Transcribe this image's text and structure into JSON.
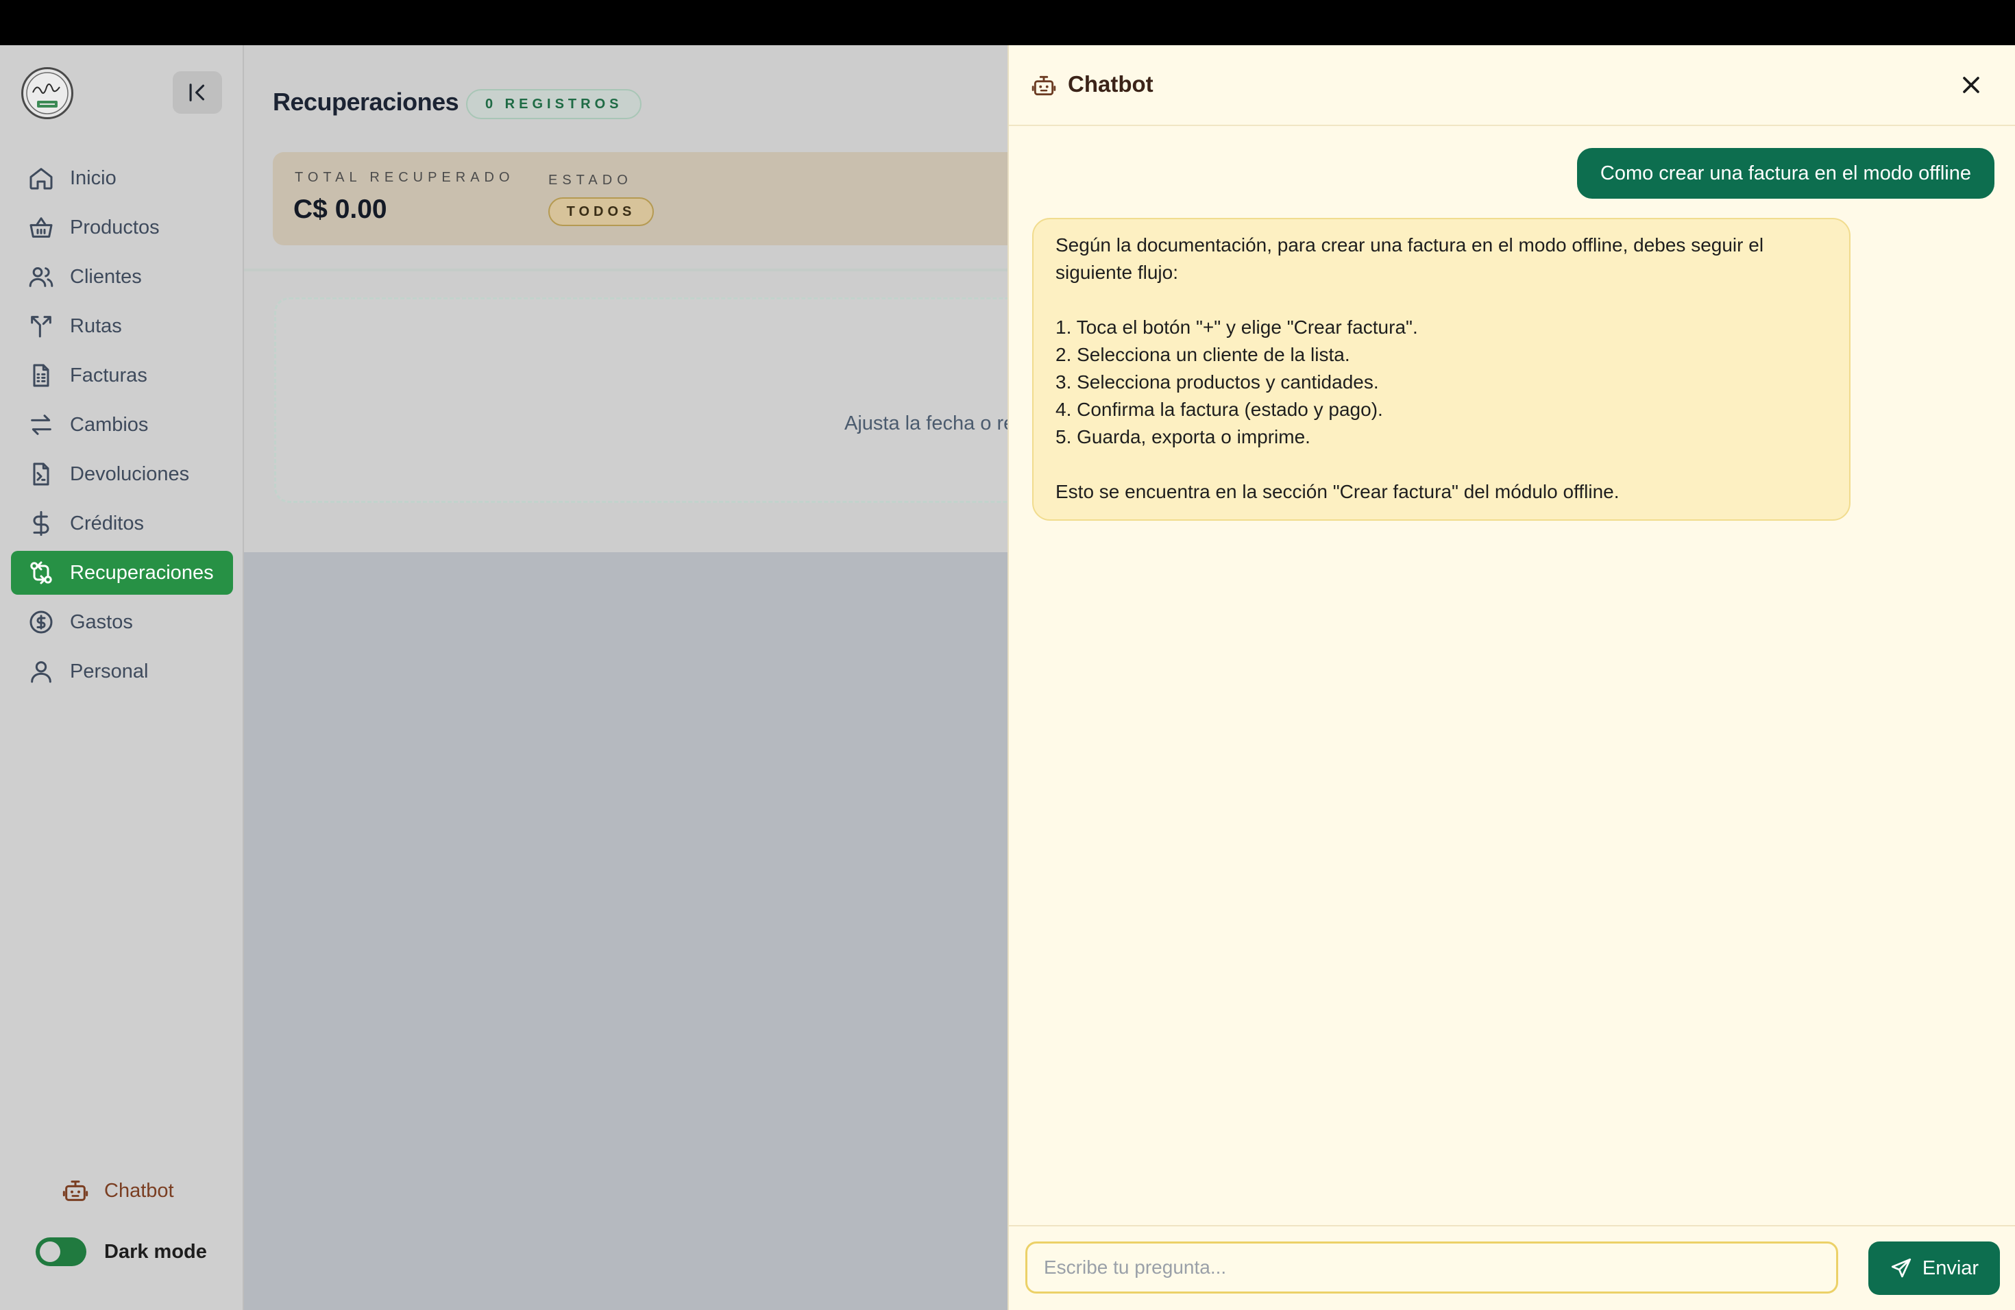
{
  "sidebar": {
    "logo_alt": "Ari-Cafe P&D logo",
    "items": [
      {
        "label": "Inicio",
        "icon": "home-icon"
      },
      {
        "label": "Productos",
        "icon": "basket-icon"
      },
      {
        "label": "Clientes",
        "icon": "users-icon"
      },
      {
        "label": "Rutas",
        "icon": "route-icon"
      },
      {
        "label": "Facturas",
        "icon": "invoice-icon"
      },
      {
        "label": "Cambios",
        "icon": "swap-icon"
      },
      {
        "label": "Devoluciones",
        "icon": "return-file-icon"
      },
      {
        "label": "Créditos",
        "icon": "dollar-icon"
      },
      {
        "label": "Recuperaciones",
        "icon": "recovery-icon",
        "active": true
      },
      {
        "label": "Gastos",
        "icon": "coin-icon"
      },
      {
        "label": "Personal",
        "icon": "person-icon"
      }
    ],
    "chatbot_label": "Chatbot",
    "dark_mode_label": "Dark mode"
  },
  "main": {
    "title": "Recuperaciones",
    "records_badge": "0 REGISTROS",
    "summary": {
      "total_label": "TOTAL RECUPERADO",
      "total_value": "C$ 0.00",
      "estado_label": "ESTADO",
      "estado_value": "TODOS"
    },
    "empty_text": "Ajusta la fecha o re"
  },
  "chat": {
    "title": "Chatbot",
    "messages": [
      {
        "role": "user",
        "text": "Como crear una factura en el modo offline"
      },
      {
        "role": "bot",
        "text": "Según la documentación, para crear una factura en el modo offline, debes seguir el siguiente flujo:\n\n1. Toca el botón \"+\" y elige \"Crear factura\".\n2. Selecciona un cliente de la lista.\n3. Selecciona productos y cantidades.\n4. Confirma la factura (estado y pago).\n5. Guarda, exporta o imprime.\n\nEsto se encuentra en la sección \"Crear factura\" del módulo offline."
      }
    ],
    "input_placeholder": "Escribe tu pregunta...",
    "send_label": "Enviar"
  },
  "colors": {
    "accent_green": "#279145",
    "chat_green": "#0d6e4f",
    "chat_bg": "#fffae8",
    "bot_bubble": "#fdf0c2"
  }
}
